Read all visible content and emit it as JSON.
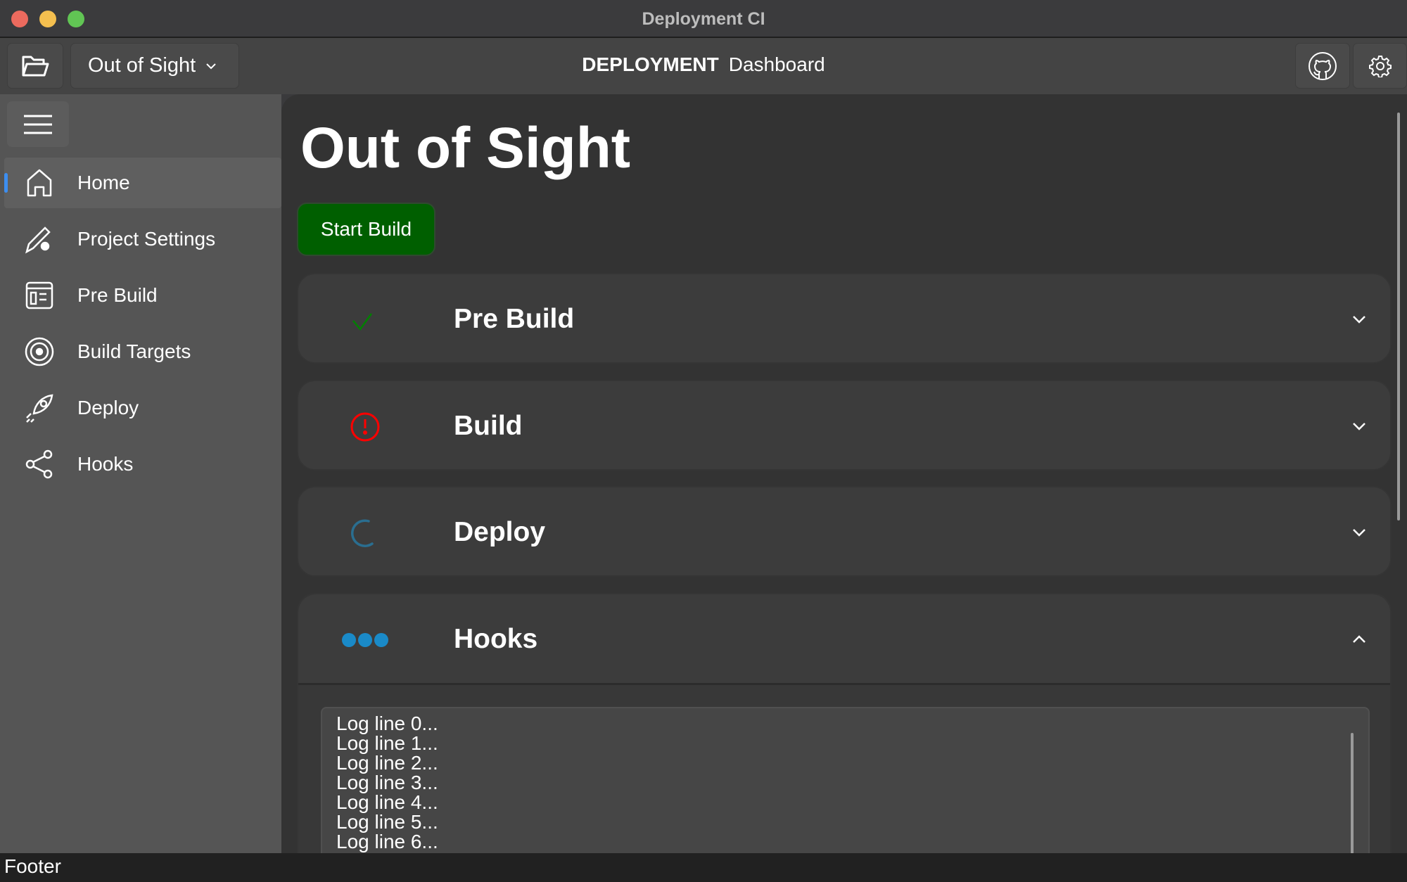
{
  "window": {
    "title": "Deployment CI"
  },
  "toolbar": {
    "project_select": "Out of Sight",
    "header_bold": "DEPLOYMENT",
    "header_text": "Dashboard"
  },
  "sidebar": {
    "items": [
      {
        "label": "Home",
        "icon": "home-icon",
        "active": true
      },
      {
        "label": "Project Settings",
        "icon": "pencil-gear-icon"
      },
      {
        "label": "Pre Build",
        "icon": "layout-icon"
      },
      {
        "label": "Build Targets",
        "icon": "target-icon"
      },
      {
        "label": "Deploy",
        "icon": "rocket-icon"
      },
      {
        "label": "Hooks",
        "icon": "share-icon"
      }
    ]
  },
  "main": {
    "title": "Out of Sight",
    "start_build": "Start Build",
    "stages": [
      {
        "title": "Pre Build",
        "status": "success",
        "expanded": false
      },
      {
        "title": "Build",
        "status": "error",
        "expanded": false
      },
      {
        "title": "Deploy",
        "status": "running",
        "expanded": false
      },
      {
        "title": "Hooks",
        "status": "pending",
        "expanded": true
      }
    ],
    "logs": [
      "Log line 0...",
      "Log line 1...",
      "Log line 2...",
      "Log line 3...",
      "Log line 4...",
      "Log line 5...",
      "Log line 6..."
    ]
  },
  "footer": {
    "text": "Footer"
  },
  "colors": {
    "success": "#008000",
    "error": "#ff0000",
    "running": "#2a6e90",
    "pending": "#1a8ac8",
    "start_button": "#005f00",
    "active_indicator": "#3d8ef0"
  }
}
